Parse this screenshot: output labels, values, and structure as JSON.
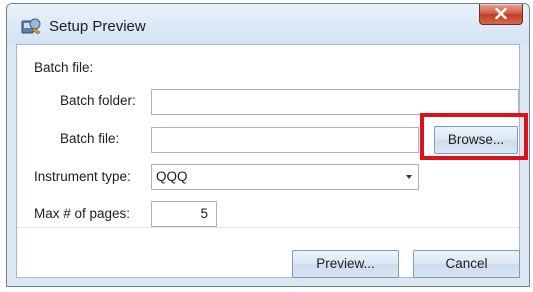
{
  "window": {
    "title": "Setup Preview",
    "app_icon": "setup-app-icon",
    "close_icon": "close-icon"
  },
  "form": {
    "section_label": "Batch file:",
    "batch_folder": {
      "label": "Batch folder:",
      "value": ""
    },
    "batch_file": {
      "label": "Batch file:",
      "value": ""
    },
    "browse_label": "Browse...",
    "instrument_type": {
      "label": "Instrument type:",
      "selected": "QQQ"
    },
    "max_pages": {
      "label": "Max # of pages:",
      "value": "5"
    }
  },
  "footer": {
    "preview_label": "Preview...",
    "cancel_label": "Cancel"
  },
  "annotation": {
    "highlight_color": "#e0101a"
  }
}
